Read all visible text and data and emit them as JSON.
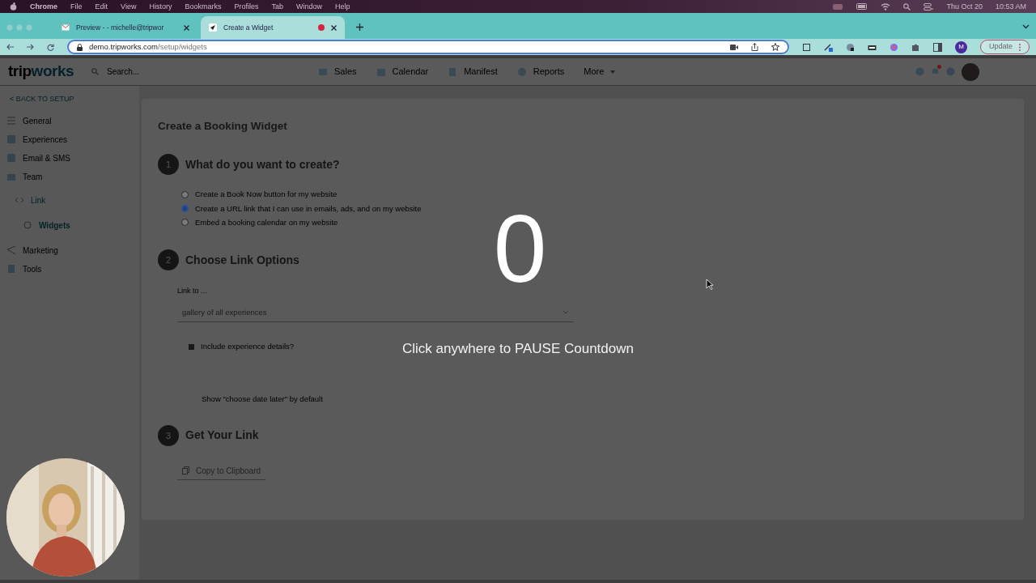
{
  "menu_bar": {
    "app": "Chrome",
    "items": [
      "File",
      "Edit",
      "View",
      "History",
      "Bookmarks",
      "Profiles",
      "Tab",
      "Window",
      "Help"
    ],
    "date": "Thu Oct 20",
    "time": "10:53 AM"
  },
  "tabs": [
    {
      "title": "Preview - - michelle@tripwor",
      "selected": false,
      "recording": false
    },
    {
      "title": "Create a Widget",
      "selected": true,
      "recording": true
    }
  ],
  "address_bar": {
    "host": "demo.tripworks.com",
    "path": "/setup/widgets"
  },
  "toolbar": {
    "profile": "M",
    "update": "Update"
  },
  "app": {
    "logo_left": "trip",
    "logo_right": "works",
    "search_placeholder": "Search...",
    "nav": [
      "Sales",
      "Calendar",
      "Manifest",
      "Reports",
      "More"
    ]
  },
  "sidebar": {
    "back": "< BACK TO SETUP",
    "items": [
      {
        "label": "General",
        "selected": false
      },
      {
        "label": "Experiences",
        "selected": false
      },
      {
        "label": "Email & SMS",
        "selected": false
      },
      {
        "label": "Team",
        "selected": false
      },
      {
        "label": "Link",
        "selected": false,
        "children": [
          {
            "label": "Widgets",
            "selected": true
          }
        ]
      },
      {
        "label": "Marketing",
        "selected": false
      },
      {
        "label": "Tools",
        "selected": false
      }
    ]
  },
  "page": {
    "title": "Create a Booking Widget",
    "steps": [
      {
        "number": "1",
        "title": "What do you want to create?"
      },
      {
        "number": "2",
        "title": "Choose Link Options"
      },
      {
        "number": "3",
        "title": "Get Your Link"
      }
    ],
    "options": [
      {
        "label": "Create a Book Now button for my website",
        "selected": false
      },
      {
        "label": "Create a URL link that I can use in emails, ads, and on my website",
        "selected": true
      },
      {
        "label": "Embed a booking calendar on my website",
        "selected": false
      }
    ],
    "link_to_label": "Link to ...",
    "link_to_value": "gallery of all experiences",
    "include_details": {
      "label": "Include experience details?",
      "checked": true
    },
    "choose_date_later": "Show \"choose date later\" by default",
    "copy_button": "Copy to Clipboard"
  },
  "overlay": {
    "countdown": "0",
    "message": "Click anywhere to PAUSE Countdown"
  }
}
